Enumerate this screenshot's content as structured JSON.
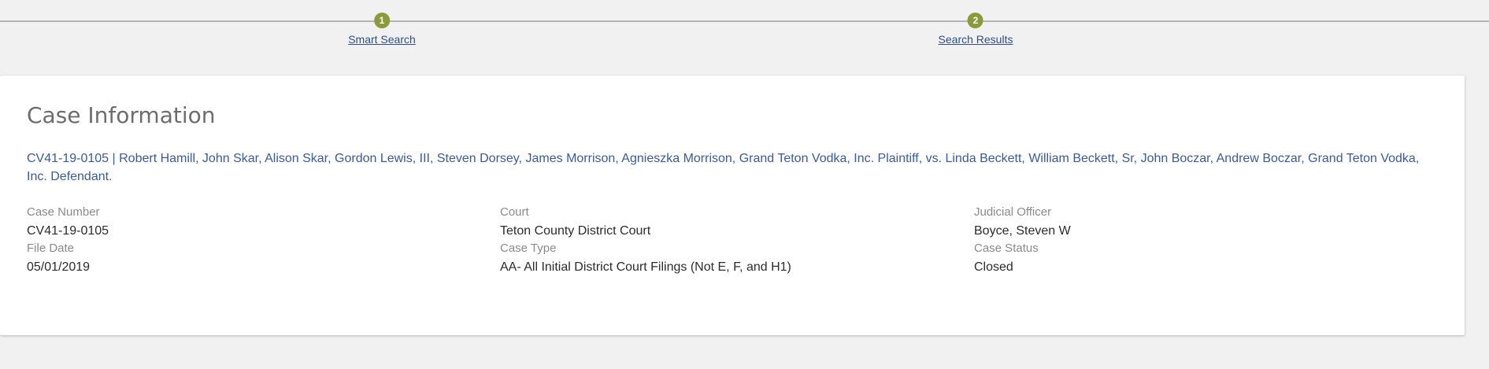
{
  "stepper": {
    "steps": [
      {
        "number": "1",
        "label": "Smart Search"
      },
      {
        "number": "2",
        "label": "Search Results"
      }
    ],
    "accent_color": "#8b9a3a"
  },
  "case": {
    "title": "Case Information",
    "caption": "CV41-19-0105 | Robert Hamill, John Skar, Alison Skar, Gordon Lewis, III, Steven Dorsey, James Morrison, Agnieszka Morrison, Grand Teton Vodka, Inc. Plaintiff, vs. Linda Beckett, William Beckett, Sr, John Boczar, Andrew Boczar, Grand Teton Vodka, Inc. Defendant.",
    "fields": {
      "case_number": {
        "label": "Case Number",
        "value": "CV41-19-0105"
      },
      "court": {
        "label": "Court",
        "value": "Teton County District Court"
      },
      "judicial_officer": {
        "label": "Judicial Officer",
        "value": "Boyce, Steven W"
      },
      "file_date": {
        "label": "File Date",
        "value": "05/01/2019"
      },
      "case_type": {
        "label": "Case Type",
        "value": "AA- All Initial District Court Filings (Not E, F, and H1)"
      },
      "case_status": {
        "label": "Case Status",
        "value": "Closed"
      }
    }
  }
}
